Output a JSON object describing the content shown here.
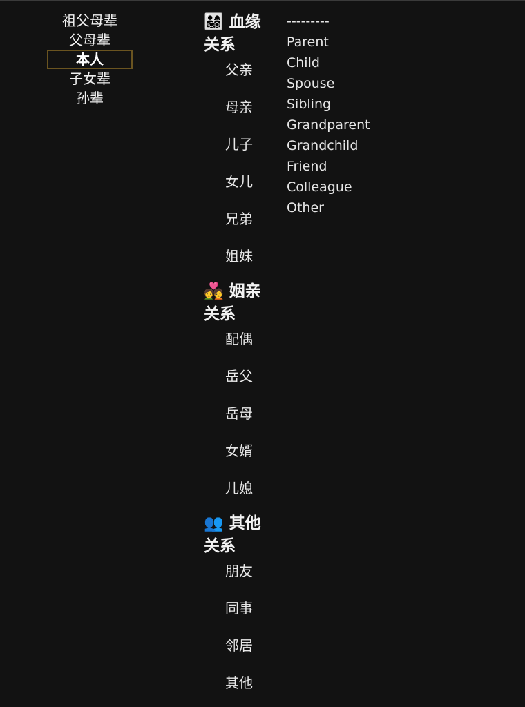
{
  "generations": [
    "祖父母辈",
    "父母辈",
    "本人",
    "子女辈",
    "孙辈"
  ],
  "selected_generation": "本人",
  "groups": [
    {
      "icon": "👨‍👩‍👧‍👦",
      "icon_name": "family-icon",
      "title": "血缘关系",
      "items": [
        "父亲",
        "母亲",
        "儿子",
        "女儿",
        "兄弟",
        "姐妹"
      ]
    },
    {
      "icon": "💑",
      "icon_name": "couple-icon",
      "title": "姻亲关系",
      "items": [
        "配偶",
        "岳父",
        "岳母",
        "女婿",
        "儿媳"
      ]
    },
    {
      "icon": "👥",
      "icon_name": "people-icon",
      "title": "其他关系",
      "items": [
        "朋友",
        "同事",
        "邻居",
        "其他"
      ]
    }
  ],
  "options": [
    "---------",
    "Parent",
    "Child",
    "Spouse",
    "Sibling",
    "Grandparent",
    "Grandchild",
    "Friend",
    "Colleague",
    "Other"
  ],
  "colors": {
    "background": "#121212",
    "text": "#e8e8e8",
    "selected_border": "#6a5420"
  }
}
